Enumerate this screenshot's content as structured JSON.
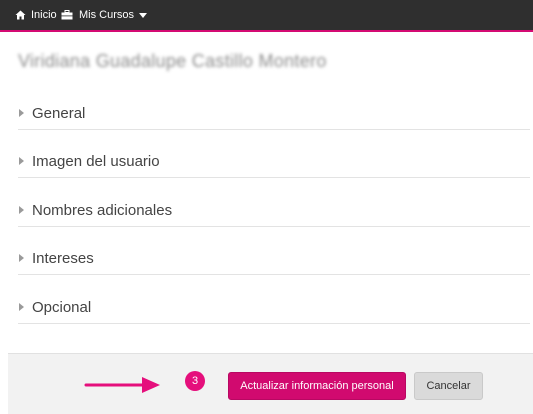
{
  "nav": {
    "home_label": "Inicio",
    "home_icon": "home-icon",
    "courses_label": "Mis Cursos",
    "courses_icon": "briefcase-icon",
    "courses_caret": "caret-down-icon"
  },
  "profile": {
    "user_name": "Viridiana Guadalupe Castillo Montero"
  },
  "sections": [
    {
      "label": "General"
    },
    {
      "label": "Imagen del usuario"
    },
    {
      "label": "Nombres adicionales"
    },
    {
      "label": "Intereses"
    },
    {
      "label": "Opcional"
    }
  ],
  "footer": {
    "step_number": "3",
    "submit_label": "Actualizar información personal",
    "cancel_label": "Cancelar"
  },
  "colors": {
    "accent": "#d10a6f",
    "topbar": "#2f2f2f",
    "badge": "#e50f7c"
  }
}
